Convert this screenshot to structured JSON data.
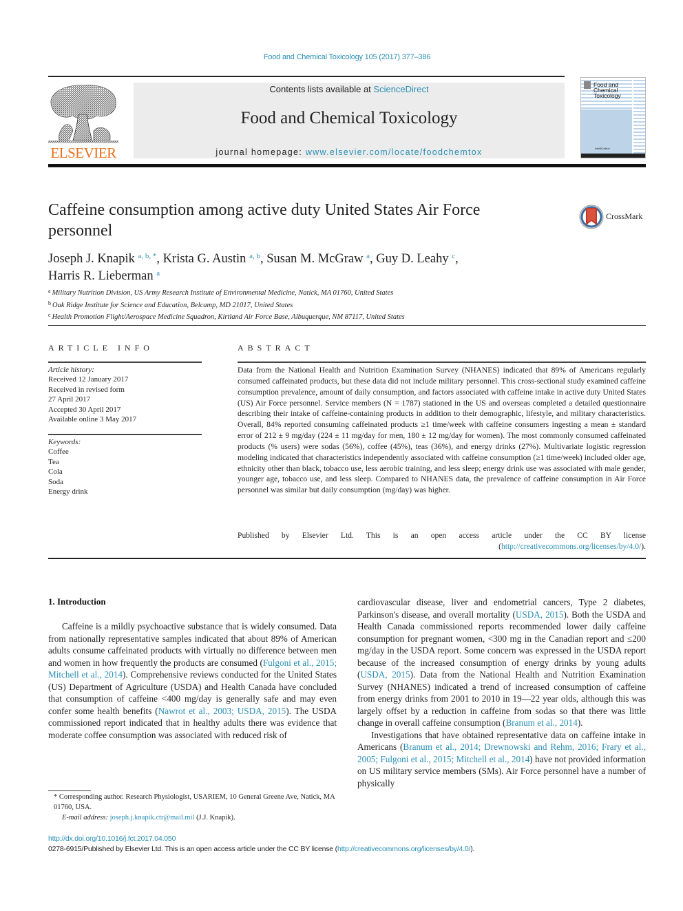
{
  "header": {
    "citation": "Food and Chemical Toxicology 105 (2017) 377–386",
    "contents_prefix": "Contents lists available at ",
    "contents_link": "ScienceDirect",
    "journal_title": "Food and Chemical Toxicology",
    "homepage_prefix": "journal homepage: ",
    "homepage_link": "www.elsevier.com/locate/foodchemtox",
    "publisher_logo": "ELSEVIER",
    "cover_title_lines": [
      "Food and",
      "Chemical",
      "Toxicology"
    ],
    "cover_publisher": "IntelliCollect",
    "crossmark_label": "CrossMark"
  },
  "article": {
    "title": "Caffeine consumption among active duty United States Air Force personnel",
    "authors": [
      {
        "name": "Joseph J. Knapik",
        "sup": "a, b, *",
        "sep": ", "
      },
      {
        "name": "Krista G. Austin",
        "sup": "a, b",
        "sep": ", "
      },
      {
        "name": "Susan M. McGraw",
        "sup": "a",
        "sep": ", "
      },
      {
        "name": "Guy D. Leahy",
        "sup": "c",
        "sep": ","
      },
      {
        "name": "Harris R. Lieberman",
        "sup": "a",
        "sep": ""
      }
    ],
    "affiliations": [
      {
        "mark": "a",
        "text": "Military Nutrition Division, US Army Research Institute of Environmental Medicine, Natick, MA 01760, United States"
      },
      {
        "mark": "b",
        "text": "Oak Ridge Institute for Science and Education, Belcamp, MD 21017, United States"
      },
      {
        "mark": "c",
        "text": "Health Promotion Flight/Aerospace Medicine Squadron, Kirtland Air Force Base, Albuquerque, NM 87117, United States"
      }
    ]
  },
  "article_info": {
    "heading": "ARTICLE INFO",
    "history_label": "Article history:",
    "history": [
      "Received 12 January 2017",
      "Received in revised form",
      "27 April 2017",
      "Accepted 30 April 2017",
      "Available online 3 May 2017"
    ],
    "keywords_label": "Keywords:",
    "keywords": [
      "Coffee",
      "Tea",
      "Cola",
      "Soda",
      "Energy drink"
    ]
  },
  "abstract": {
    "heading": "ABSTRACT",
    "body": "Data from the National Health and Nutrition Examination Survey (NHANES) indicated that 89% of Americans regularly consumed caffeinated products, but these data did not include military personnel. This cross-sectional study examined caffeine consumption prevalence, amount of daily consumption, and factors associated with caffeine intake in active duty United States (US) Air Force personnel. Service members (N = 1787) stationed in the US and overseas completed a detailed questionnaire describing their intake of caffeine-containing products in addition to their demographic, lifestyle, and military characteristics. Overall, 84% reported consuming caffeinated products ≥1 time/week with caffeine consumers ingesting a mean ± standard error of 212 ± 9 mg/day (224 ± 11 mg/day for men, 180 ± 12 mg/day for women). The most commonly consumed caffeinated products (% users) were sodas (56%), coffee (45%), teas (36%), and energy drinks (27%). Multivariate logistic regression modeling indicated that characteristics independently associated with caffeine consumption (≥1 time/week) included older age, ethnicity other than black, tobacco use, less aerobic training, and less sleep; energy drink use was associated with male gender, younger age, tobacco use, and less sleep. Compared to NHANES data, the prevalence of caffeine consumption in Air Force personnel was similar but daily consumption (mg/day) was higher.",
    "license_prefix": "Published by Elsevier Ltd. This is an open access article under the CC BY license (",
    "license_link": "http://creativecommons.org/licenses/by/4.0/",
    "license_suffix": ")."
  },
  "introduction": {
    "heading": "1.  Introduction",
    "left_paragraph": [
      {
        "t": "Caffeine is a mildly psychoactive substance that is widely consumed. Data from nationally representative samples indicated that about 89% of American adults consume caffeinated products with virtually no difference between men and women in how frequently the products are consumed ("
      },
      {
        "link": "Fulgoni et al., 2015; Mitchell et al., 2014"
      },
      {
        "t": "). Comprehensive reviews conducted for the United States (US) Department of Agriculture (USDA) and Health Canada have concluded that consumption of caffeine <400 mg/day is generally safe and may even confer some health benefits ("
      },
      {
        "link": "Nawrot et al., 2003; USDA, 2015"
      },
      {
        "t": "). The USDA commissioned report indicated that in healthy adults there was evidence that moderate coffee consumption was associated with reduced risk of"
      }
    ],
    "right_paragraph_1": [
      {
        "t": "cardiovascular disease, liver and endometrial cancers, Type 2 diabetes, Parkinson's disease, and overall mortality ("
      },
      {
        "link": "USDA, 2015"
      },
      {
        "t": "). Both the USDA and Health Canada commissioned reports recommended lower daily caffeine consumption for pregnant women, <300 mg in the Canadian report and ≤200 mg/day in the USDA report. Some concern was expressed in the USDA report because of the increased consumption of energy drinks by young adults ("
      },
      {
        "link": "USDA, 2015"
      },
      {
        "t": "). Data from the National Health and Nutrition Examination Survey (NHANES) indicated a trend of increased consumption of caffeine from energy drinks from 2001 to 2010 in 19—22 year olds, although this was largely offset by a reduction in caffeine from sodas so that there was little change in overall caffeine consumption ("
      },
      {
        "link": "Branum et al., 2014"
      },
      {
        "t": ")."
      }
    ],
    "right_paragraph_2": [
      {
        "t": "Investigations that have obtained representative data on caffeine intake in Americans ("
      },
      {
        "link": "Branum et al., 2014; Drewnowski and Rehm, 2016; Frary et al., 2005; Fulgoni et al., 2015; Mitchell et al., 2014"
      },
      {
        "t": ") have not provided information on US military service members (SMs). Air Force personnel have a number of physically"
      }
    ]
  },
  "footnote": {
    "star_text": "* Corresponding author. Research Physiologist, USARIEM, 10 General Greene Ave, Natick, MA 01760, USA.",
    "email_label": "E-mail address: ",
    "email": "joseph.j.knapik.ctr@mail.mil",
    "email_suffix": " (J.J. Knapik)."
  },
  "doi": {
    "link": "http://dx.doi.org/10.1016/j.fct.2017.04.050",
    "license_prefix": "0278-6915/Published by Elsevier Ltd. This is an open access article under the CC BY license (",
    "license_link": "http://creativecommons.org/licenses/by/4.0/",
    "license_suffix": ")."
  },
  "colors": {
    "link": "#2a8fb5",
    "elsevier_orange": "#e9711c",
    "masthead_bg": "#ececec"
  }
}
